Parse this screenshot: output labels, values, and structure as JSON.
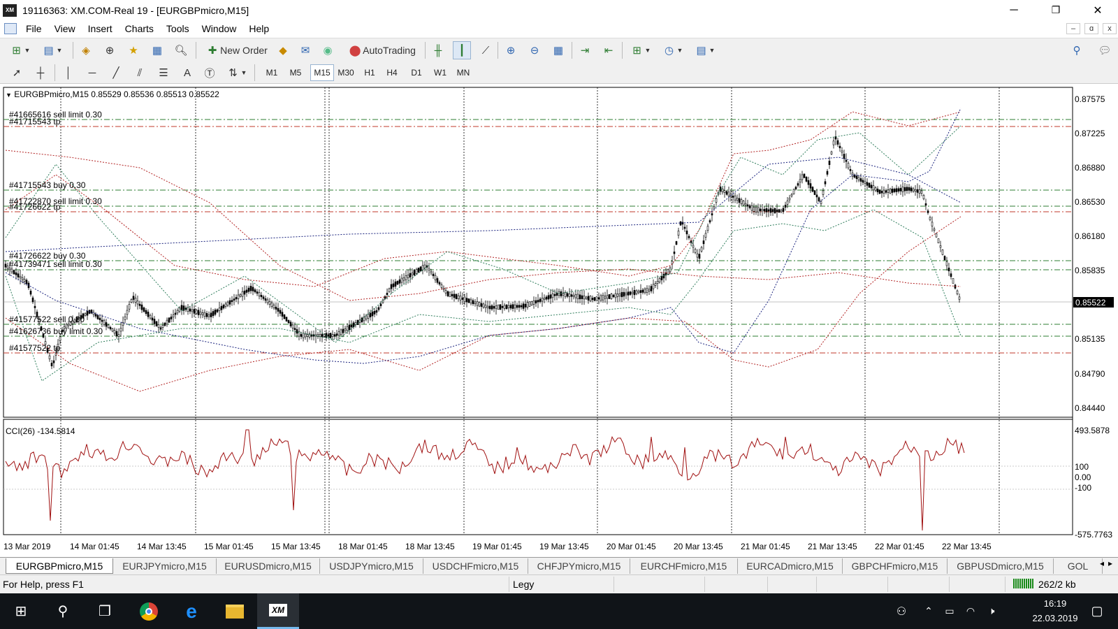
{
  "window": {
    "title": "19116363: XM.COM-Real 19 - [EURGBPmicro,M15]",
    "logo_text": "XM",
    "minimize": "─",
    "maximize": "❐",
    "close": "✕"
  },
  "menu": {
    "items": [
      "File",
      "View",
      "Insert",
      "Charts",
      "Tools",
      "Window",
      "Help"
    ],
    "mdi_min": "–",
    "mdi_restore": "ɑ",
    "mdi_close": "x"
  },
  "toolbar": {
    "new_order_label": "New Order",
    "autotrading_label": "AutoTrading",
    "timeframes": [
      "M1",
      "M5",
      "M15",
      "M30",
      "H1",
      "H4",
      "D1",
      "W1",
      "MN"
    ],
    "active_timeframe": "M15"
  },
  "chart": {
    "symbol_header": "EURGBPmicro,M15  0.85529 0.85536 0.85513 0.85522",
    "current_price": "0.85522",
    "price_labels": [
      "0.87575",
      "0.87225",
      "0.86880",
      "0.86530",
      "0.86180",
      "0.85835",
      "0.85135",
      "0.84790",
      "0.84440"
    ],
    "order_labels": [
      "#41665616 sell limit 0.30",
      "#41715543 tp",
      "#41715543 buy 0.30",
      "#41722870 sell limit 0.30",
      "#41726622 tp",
      "#41726622 buy 0.30",
      "#41739471 sell limit 0.30",
      "#41577522 sell 0.30",
      "#41626736 buy limit 0.30",
      "#41577522 tp"
    ],
    "time_labels": [
      "13 Mar 2019",
      "14 Mar 01:45",
      "14 Mar 13:45",
      "15 Mar 01:45",
      "15 Mar 13:45",
      "18 Mar 01:45",
      "18 Mar 13:45",
      "19 Mar 01:45",
      "19 Mar 13:45",
      "20 Mar 01:45",
      "20 Mar 13:45",
      "21 Mar 01:45",
      "21 Mar 13:45",
      "22 Mar 01:45",
      "22 Mar 13:45"
    ],
    "colors": {
      "candles": "#000000",
      "buy_line": "#2e7d32",
      "sell_line": "#c0392b",
      "band_red": "#b22222",
      "band_blue": "#1a237e",
      "band_green": "#2e7d5b",
      "cci": "#a01010"
    }
  },
  "cci": {
    "header": "CCI(26) -134.5814",
    "levels": [
      "493.5878",
      "100",
      "0.00",
      "-100",
      "-575.7763"
    ]
  },
  "tabs": [
    "EURGBPmicro,M15",
    "EURJPYmicro,M15",
    "EURUSDmicro,M15",
    "USDJPYmicro,M15",
    "USDCHFmicro,M15",
    "CHFJPYmicro,M15",
    "EURCHFmicro,M15",
    "EURCADmicro,M15",
    "GBPCHFmicro,M15",
    "GBPUSDmicro,M15",
    "GOL"
  ],
  "status": {
    "help": "For Help, press F1",
    "profile": "Legy",
    "traffic": "262/2 kb"
  },
  "taskbar": {
    "time": "16:19",
    "date": "22.03.2019"
  }
}
